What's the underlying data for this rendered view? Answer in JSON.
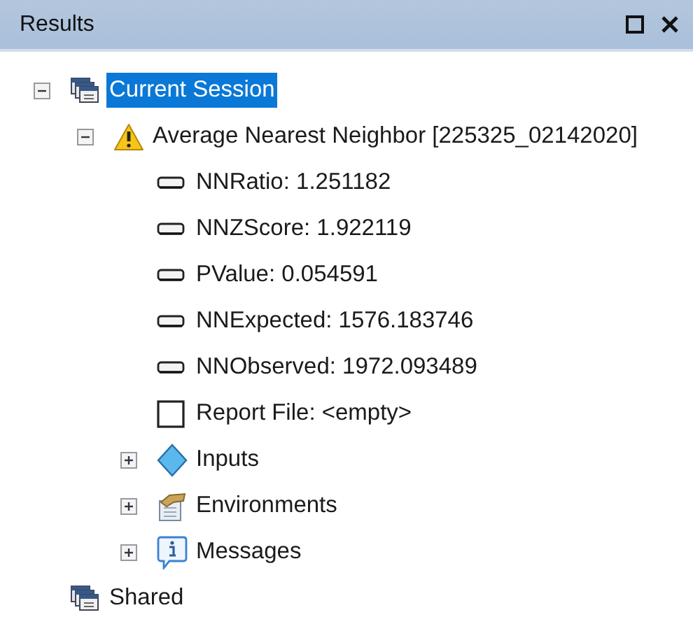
{
  "window": {
    "title": "Results"
  },
  "tree": [
    {
      "label": "Current Session",
      "kind": "session",
      "expanded": true,
      "selected": true,
      "children": [
        {
          "label": "Average Nearest Neighbor [225325_02142020]",
          "kind": "warning",
          "expanded": true,
          "selected": false,
          "children": [
            {
              "label": "NNRatio: 1.251182",
              "kind": "output",
              "selected": false
            },
            {
              "label": "NNZScore: 1.922119",
              "kind": "output",
              "selected": false
            },
            {
              "label": "PValue: 0.054591",
              "kind": "output",
              "selected": false
            },
            {
              "label": "NNExpected: 1576.183746",
              "kind": "output",
              "selected": false
            },
            {
              "label": "NNObserved: 1972.093489",
              "kind": "output",
              "selected": false
            },
            {
              "label": "Report File: <empty>",
              "kind": "report",
              "selected": false
            },
            {
              "label": "Inputs",
              "kind": "inputs",
              "expanded": false,
              "selected": false
            },
            {
              "label": "Environments",
              "kind": "environments",
              "expanded": false,
              "selected": false
            },
            {
              "label": "Messages",
              "kind": "messages",
              "expanded": false,
              "selected": false
            }
          ]
        }
      ]
    },
    {
      "label": "Shared",
      "kind": "session",
      "selected": false
    }
  ]
}
